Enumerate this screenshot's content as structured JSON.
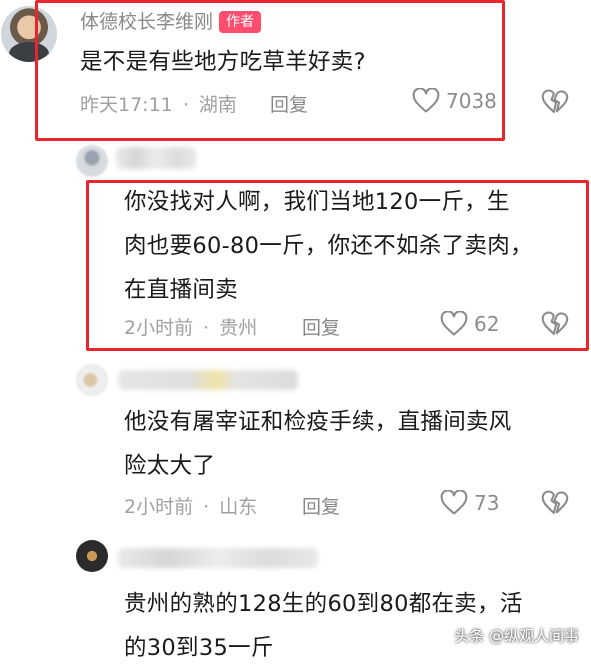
{
  "comments": [
    {
      "author": "体德校长李维刚",
      "badge": "作者",
      "text_lines": [
        "是不是有些地方吃草羊好卖?"
      ],
      "time": "昨天17:11",
      "location": "湖南",
      "reply_label": "回复",
      "likes": "7038"
    },
    {
      "text_lines": [
        "你没找对人啊，我们当地120一斤，生",
        "肉也要60-80一斤，你还不如杀了卖肉，",
        "在直播间卖"
      ],
      "time": "2小时前",
      "location": "贵州",
      "reply_label": "回复",
      "likes": "62"
    },
    {
      "text_lines": [
        "他没有屠宰证和检疫手续，直播间卖风",
        "险太大了"
      ],
      "time": "2小时前",
      "location": "山东",
      "reply_label": "回复",
      "likes": "73"
    },
    {
      "text_lines": [
        "贵州的熟的128生的60到80都在卖，活",
        "的30到35一斤"
      ]
    }
  ],
  "meta_separator": "·",
  "watermark": "头条 @纵观人间事",
  "colors": {
    "highlight_border": "#e8262b",
    "author_badge": "#ff4d6d"
  },
  "icons": {
    "like": "heart-outline-icon",
    "dislike": "broken-heart-icon"
  }
}
